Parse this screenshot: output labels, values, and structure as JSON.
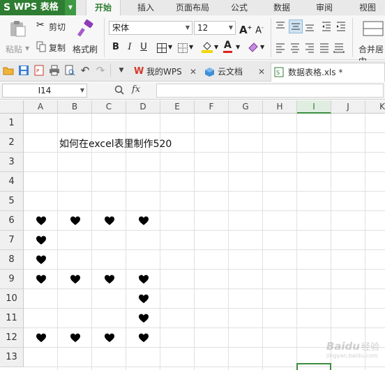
{
  "app": {
    "name": "WPS 表格",
    "menu_tabs": [
      "开始",
      "插入",
      "页面布局",
      "公式",
      "数据",
      "审阅",
      "视图"
    ],
    "active_menu_tab": "开始"
  },
  "ribbon": {
    "paste_label": "粘贴",
    "cut_label": "剪切",
    "copy_label": "复制",
    "format_painter_label": "格式刷",
    "font_name": "宋体",
    "font_size": "12",
    "merge_center_label": "合并居中",
    "bold_glyph": "B",
    "italic_glyph": "I",
    "underline_glyph": "U",
    "font_color_glyph": "A",
    "grow_font_glyph": "A",
    "shrink_font_glyph": "A"
  },
  "doc_tabs": [
    {
      "label": "我的WPS",
      "icon": "wps-logo-icon",
      "active": false
    },
    {
      "label": "云文档",
      "icon": "cloud-doc-icon",
      "active": false
    },
    {
      "label": "数据表格.xls *",
      "icon": "spreadsheet-file-icon",
      "active": true
    }
  ],
  "formula_bar": {
    "name_box": "I14",
    "fx_label": "fx",
    "formula": ""
  },
  "sheet": {
    "columns": [
      "A",
      "B",
      "C",
      "D",
      "E",
      "F",
      "G",
      "H",
      "I",
      "J",
      "K"
    ],
    "selected_column": "I",
    "rows": [
      "1",
      "2",
      "3",
      "4",
      "5",
      "6",
      "7",
      "8",
      "9",
      "10",
      "11",
      "12",
      "13"
    ],
    "cells": [
      {
        "ref": "B2",
        "text": "如何在excel表里制作520"
      }
    ],
    "hearts": [
      "A6",
      "B6",
      "C6",
      "D6",
      "A7",
      "A8",
      "A9",
      "B9",
      "C9",
      "D9",
      "D10",
      "D11",
      "A12",
      "B12",
      "C12",
      "D12"
    ],
    "active_cell": "I14"
  },
  "watermark": {
    "brand": "Baidu",
    "sub": "经验",
    "url": "jingyan.baidu.com"
  },
  "colors": {
    "brand_green": "#2e7d32",
    "heart": "#000000",
    "selection": "#3a8e3e"
  }
}
